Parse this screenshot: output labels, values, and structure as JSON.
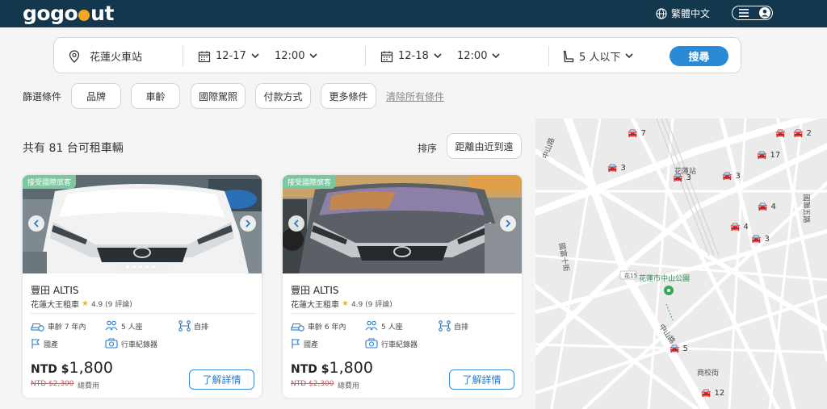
{
  "header": {
    "logo_left": "gogo",
    "logo_right": "ut",
    "language": "繁體中文"
  },
  "search": {
    "location": "花蓮火車站",
    "pickup_date": "12-17",
    "pickup_time": "12:00",
    "return_date": "12-18",
    "return_time": "12:00",
    "seats": "5 人以下",
    "search_label": "搜尋"
  },
  "filters": {
    "label": "篩選條件",
    "brand": "品牌",
    "age": "車齡",
    "license": "國際駕照",
    "payment": "付款方式",
    "more": "更多條件",
    "clear": "清除所有條件"
  },
  "results": {
    "count": "共有 81 台可租車輛",
    "sort_label": "排序",
    "sort_value": "距離由近到遠"
  },
  "cars": [
    {
      "badge": "接受國際旅客",
      "title": "豐田 ALTIS",
      "shop": "花蓮大王租車",
      "rating": "4.9 (9 評論)",
      "age": "車齡 7 年內",
      "seats": "5 人座",
      "drive": "自排",
      "type": "國產",
      "recorder": "行車紀錄器",
      "currency": "NTD $",
      "price": "1,800",
      "old_price": "NTD $2,300",
      "total_label": "總費用",
      "detail": "了解詳情"
    },
    {
      "badge": "接受國際旅客",
      "title": "豐田 ALTIS",
      "shop": "花蓮大王租車",
      "rating": "4.9 (9 評論)",
      "age": "車齡 6 年內",
      "seats": "5 人座",
      "drive": "自排",
      "type": "國產",
      "recorder": "行車紀錄器",
      "currency": "NTD $",
      "price": "1,800",
      "old_price": "NTD $2,300",
      "total_label": "總費用",
      "detail": "了解詳情"
    }
  ],
  "map": {
    "pins": [
      "7",
      "3",
      "3",
      "3",
      "2",
      "2",
      "17",
      "4",
      "4",
      "3",
      "5",
      "12"
    ],
    "labels": {
      "station": "花蓮站",
      "park": "花蓮市中山公園",
      "road_zhongshan": "中山路",
      "road_15": "花15",
      "road_shangxiao": "商校街",
      "road_zhongshan2": "中山路",
      "road_guoshi": "國聯五路",
      "road_guo": "國富十街"
    }
  }
}
